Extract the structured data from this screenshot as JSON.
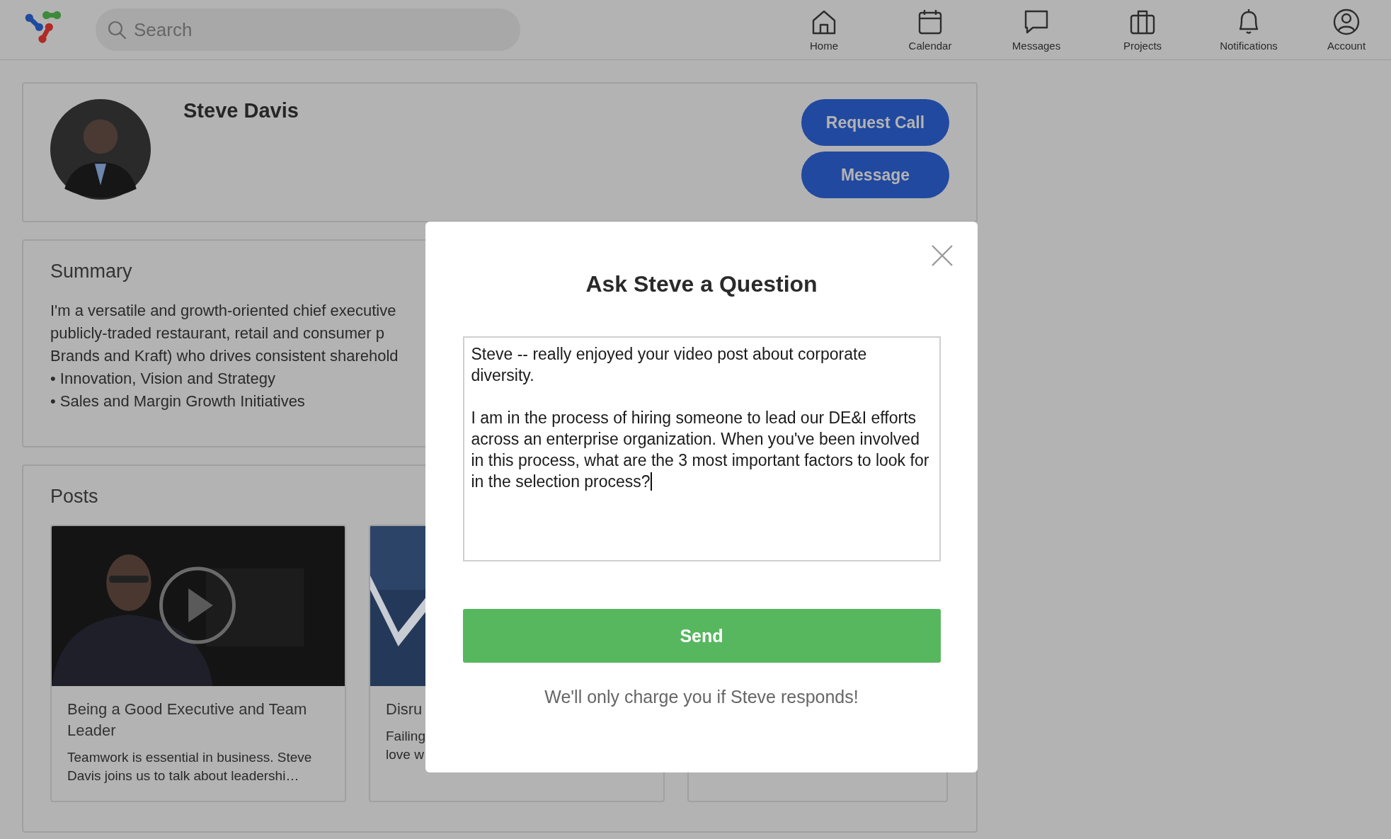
{
  "header": {
    "search": {
      "placeholder": "Search"
    },
    "nav": [
      {
        "label": "Home"
      },
      {
        "label": "Calendar"
      },
      {
        "label": "Messages"
      },
      {
        "label": "Projects"
      },
      {
        "label": "Notifications"
      },
      {
        "label": "Account"
      }
    ]
  },
  "profile": {
    "name": "Steve Davis",
    "buttons": [
      "Request Call",
      "Message"
    ]
  },
  "summary": {
    "title": "Summary",
    "lines": [
      "I'm a versatile and growth-oriented chief executive",
      "publicly-traded restaurant, retail and consumer p",
      "Brands and Kraft) who drives consistent sharehold",
      "• Innovation, Vision and Strategy",
      "• Sales and Margin Growth Initiatives"
    ]
  },
  "posts": {
    "title": "Posts",
    "items": [
      {
        "kind": "video",
        "title": "Being a Good Executive and Team Leader",
        "excerpt": "Teamwork is essential in business. Steve Davis joins us to talk about leadershi…"
      },
      {
        "kind": "pattern",
        "title": "Disru",
        "excerpt_lines": [
          "Failing",
          "love w"
        ]
      },
      {
        "kind": "hidden"
      }
    ]
  },
  "modal": {
    "title": "Ask Steve a Question",
    "message": {
      "value": "Steve -- really enjoyed your video post about corporate diversity.\n\nI am in the process of hiring someone to lead our DE&I efforts across an enterprise organization. When you've been involved in this process, what are the 3 most important factors to look for in the selection process?"
    },
    "send_button": "Send",
    "note": "We'll only charge you if Steve responds!"
  }
}
